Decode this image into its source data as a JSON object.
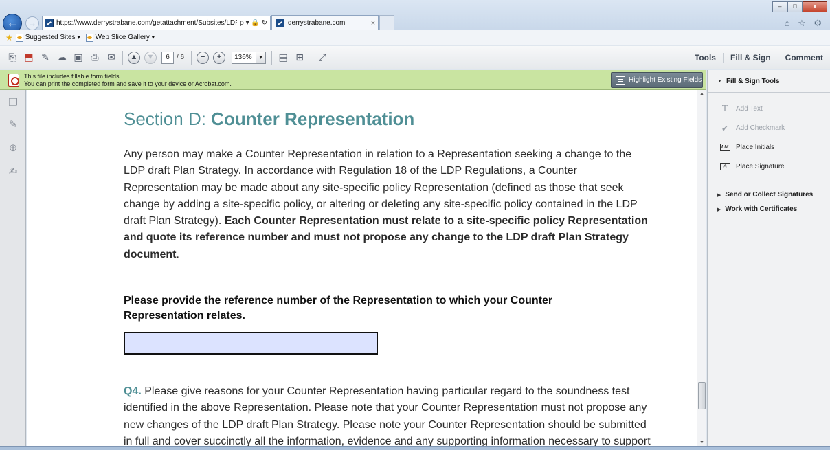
{
  "browser": {
    "url": "https://www.derrystrabane.com/getattachment/Subsites/LDF",
    "address_tools": "ρ ▾ 🔒 ↻",
    "tab_title": "derrystrabane.com",
    "tab_close": "×",
    "back_icon": "←",
    "forward_icon": "→",
    "right_icons": "⌂ ☆ ⚙",
    "window_controls": {
      "minimize": "–",
      "restore": "□",
      "close": "x"
    }
  },
  "favorites": {
    "items": [
      {
        "label": "Suggested Sites",
        "has_caret": true
      },
      {
        "label": "Web Slice Gallery",
        "has_caret": true
      }
    ],
    "caret": "▾"
  },
  "toolbar": {
    "page_number": "6",
    "page_total": "/ 6",
    "zoom": "136%",
    "zoom_caret": "▾",
    "prev_icon": "▲",
    "next_icon": "▼",
    "zoom_out_icon": "−",
    "zoom_in_icon": "+",
    "links": [
      "Tools",
      "Fill & Sign",
      "Comment"
    ]
  },
  "notice": {
    "line1": "This file includes fillable form fields.",
    "line2": "You can print the completed form and save it to your device or Acrobat.com.",
    "highlight_button": "Highlight Existing Fields"
  },
  "document": {
    "title_light": "Section D: ",
    "title_bold": "Counter Representation",
    "intro_text": "Any person may make a Counter Representation in relation to a Representation seeking a change to the LDP draft Plan Strategy. In accordance with Regulation 18 of the LDP Regulations, a Counter Representation may be made about any site-specific policy Representation (defined as those that seek change by adding a site-specific policy, or altering or deleting any site-specific policy contained in the LDP draft Plan Strategy). ",
    "intro_bold": "Each Counter Representation must relate to a site-specific policy Representation and quote its reference number and must not propose any change to the LDP draft Plan Strategy document",
    "intro_end": ".",
    "ref_question": "Please provide the reference number of the Representation to which your Counter Representation relates.",
    "ref_field_value": "",
    "q4_label": "Q4.",
    "q4_text": " Please give reasons for your Counter Representation having particular regard to the soundness test identified in the above Representation. Please note that your Counter Representation must not propose any new changes of the LDP draft Plan Strategy. Please note your Counter Representation should be submitted in full and cover succinctly all the information, evidence and any supporting information necessary to support / justify your submission. There"
  },
  "panel": {
    "header": "Fill & Sign Tools",
    "header_tri": "▼",
    "tools": [
      {
        "label": "Add Text",
        "icon": "T",
        "enabled": false
      },
      {
        "label": "Add Checkmark",
        "icon": "✔",
        "enabled": false
      },
      {
        "label": "Place Initials",
        "icon": "LM",
        "enabled": true
      },
      {
        "label": "Place Signature",
        "icon": "✍",
        "enabled": true
      }
    ],
    "sections": [
      {
        "label": "Send or Collect Signatures",
        "tri": "▶"
      },
      {
        "label": "Work with Certificates",
        "tri": "▶"
      }
    ]
  },
  "colors": {
    "accent_teal": "#4f8f95",
    "notice_green": "#c9e4a1",
    "field_fill": "#dce3ff"
  }
}
